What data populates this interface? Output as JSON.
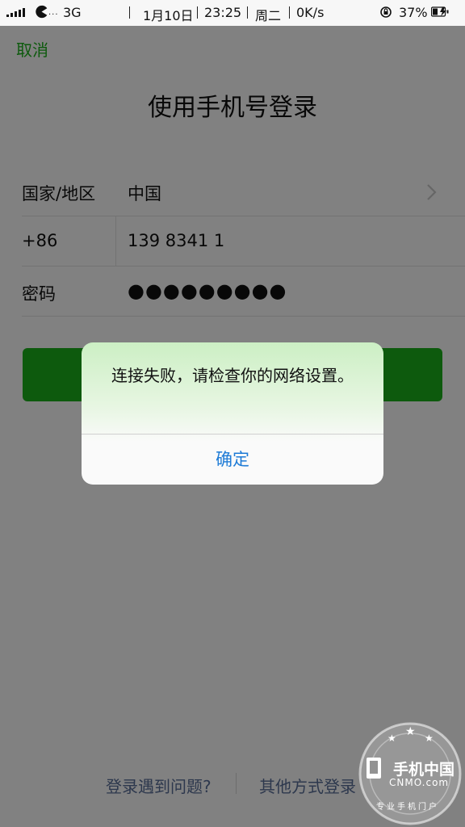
{
  "status_bar": {
    "network": "3G",
    "date": "1月10日",
    "time": "23:25",
    "weekday": "周二",
    "speed": "0K/s",
    "battery": "37%",
    "pac_dots": "···"
  },
  "header": {
    "cancel_label": "取消",
    "title": "使用手机号登录"
  },
  "form": {
    "region_label": "国家/地区",
    "region_value": "中国",
    "country_code": "+86",
    "phone_value": "139 8341 1",
    "password_label": "密码",
    "password_value": "●●●●●●●●●"
  },
  "footer": {
    "trouble_link": "登录遇到问题?",
    "other_login_link": "其他方式登录"
  },
  "alert": {
    "message": "连接失败，请检查你的网络设置。",
    "ok_label": "确定"
  },
  "watermark": {
    "brand": "手机中国",
    "domain": "CNMO.com",
    "tagline": "专业手机门户"
  },
  "colors": {
    "accent": "#1aad19",
    "link": "#576b95",
    "alert_button": "#1e7bd6"
  }
}
